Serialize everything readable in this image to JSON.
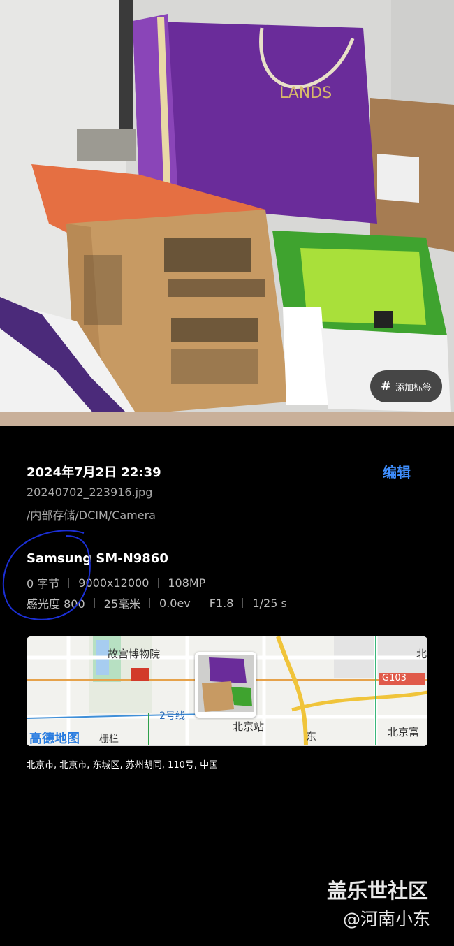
{
  "photo": {
    "tag_button_label": "添加标签",
    "tag_icon": "hash-icon",
    "bag_brand_text": "LANDS"
  },
  "details": {
    "datetime": "2024年7月2日 22:39",
    "edit_label": "编辑",
    "filename": "20240702_223916.jpg",
    "path": "/内部存储/DCIM/Camera"
  },
  "camera": {
    "model": "Samsung SM-N9860",
    "size": "0 字节",
    "resolution": "9000x12000",
    "megapixels": "108MP",
    "iso": "感光度 800",
    "focal_length": "25毫米",
    "exposure_bias": "0.0ev",
    "aperture": "F1.8",
    "shutter": "1/25 s"
  },
  "map": {
    "labels": {
      "palace_museum": "故宫博物院",
      "line2": "2号线",
      "beijing_station": "北京站",
      "dashilan": "栅栏",
      "road_g103": "G103",
      "east": "东",
      "beijing_fu": "北京富",
      "bei": "北",
      "gaode_logo": "高德地图"
    }
  },
  "location": {
    "address": "北京市, 北京市, 东城区, 苏州胡同, 110号, 中国"
  },
  "watermark": {
    "community": "盖乐世社区",
    "author": "@河南小东"
  },
  "colors": {
    "accent": "#3f8fff",
    "background": "#000000",
    "annotation_circle": "#1b2fd6"
  }
}
